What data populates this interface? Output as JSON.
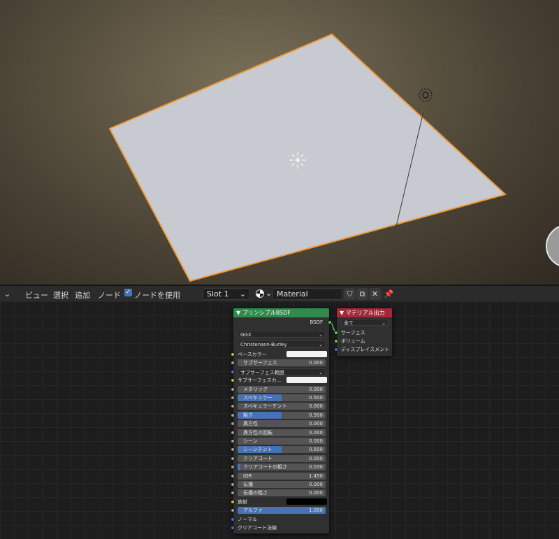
{
  "header": {
    "menu_view": "ビュー",
    "menu_select": "選択",
    "menu_add": "追加",
    "menu_node": "ノード",
    "use_nodes_label": "ノードを使用",
    "slot": "Slot 1",
    "material_name": "Material"
  },
  "principled_node": {
    "title": "▼ プリンシプルBSDF",
    "output_label": "BSDF",
    "distribution": "GGX",
    "subsurface_method": "Christensen-Burley",
    "rows": [
      {
        "label": "ベースカラー",
        "kind": "color",
        "color": "#f2f2f2",
        "socket": "#c7c729"
      },
      {
        "label": "サブサーフェス",
        "value": "0.000",
        "kind": "field",
        "fill": 0,
        "socket": "#a1a1a1"
      },
      {
        "label": "サブサーフェス範囲",
        "kind": "select",
        "socket": "#6363c7"
      },
      {
        "label": "サブサーフェスカ...",
        "kind": "color",
        "color": "#f2f2f2",
        "socket": "#c7c729"
      },
      {
        "label": "メタリック",
        "value": "0.000",
        "kind": "field",
        "fill": 0,
        "socket": "#a1a1a1"
      },
      {
        "label": "スペキュラー",
        "value": "0.500",
        "kind": "field",
        "fill": 0.5,
        "socket": "#a1a1a1"
      },
      {
        "label": "スペキュラーチント",
        "value": "0.000",
        "kind": "field",
        "fill": 0,
        "socket": "#a1a1a1"
      },
      {
        "label": "粗さ",
        "value": "0.500",
        "kind": "field",
        "fill": 0.5,
        "socket": "#a1a1a1"
      },
      {
        "label": "異方性",
        "value": "0.000",
        "kind": "field",
        "fill": 0,
        "socket": "#a1a1a1"
      },
      {
        "label": "異方性の回転",
        "value": "0.000",
        "kind": "field",
        "fill": 0,
        "socket": "#a1a1a1"
      },
      {
        "label": "シーン",
        "value": "0.000",
        "kind": "field",
        "fill": 0,
        "socket": "#a1a1a1"
      },
      {
        "label": "シーンチント",
        "value": "0.500",
        "kind": "field",
        "fill": 0.5,
        "socket": "#a1a1a1"
      },
      {
        "label": "クリアコート",
        "value": "0.000",
        "kind": "field",
        "fill": 0,
        "socket": "#a1a1a1"
      },
      {
        "label": "クリアコートの粗さ",
        "value": "0.030",
        "kind": "field",
        "fill": 0.03,
        "socket": "#a1a1a1"
      },
      {
        "label": "IOR",
        "value": "1.450",
        "kind": "field",
        "fill": 0,
        "socket": "#a1a1a1"
      },
      {
        "label": "伝播",
        "value": "0.000",
        "kind": "field",
        "fill": 0,
        "socket": "#a1a1a1"
      },
      {
        "label": "伝播の粗さ",
        "value": "0.000",
        "kind": "field",
        "fill": 0,
        "socket": "#a1a1a1"
      },
      {
        "label": "放射",
        "kind": "color",
        "color": "#000000",
        "socket": "#c7c729"
      },
      {
        "label": "アルファ",
        "value": "1.000",
        "kind": "field",
        "fill": 1,
        "socket": "#a1a1a1"
      },
      {
        "label": "ノーマル",
        "kind": "plain",
        "socket": "#6363c7"
      },
      {
        "label": "クリアコート法線",
        "kind": "plain",
        "socket": "#6363c7"
      }
    ]
  },
  "output_node": {
    "title": "▼ マテリアル出力",
    "target": "全て",
    "inputs": [
      {
        "label": "サーフェス",
        "socket": "#63c763"
      },
      {
        "label": "ボリューム",
        "socket": "#63c763"
      },
      {
        "label": "ディスプレイスメント",
        "socket": "#6363c7"
      }
    ]
  },
  "colors": {
    "principled_header": "#2f8a4c",
    "output_header": "#a3283a",
    "selection_outline": "#f09a3a",
    "plane": "#c8cad1"
  }
}
